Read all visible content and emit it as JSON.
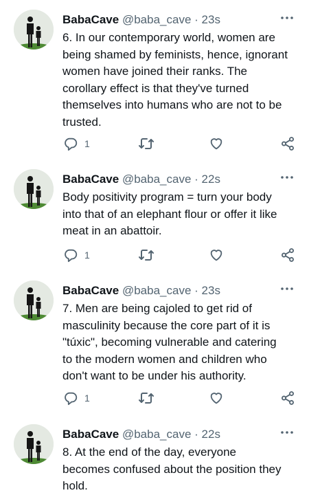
{
  "tweets": [
    {
      "display_name": "BabaCave",
      "handle": "@baba_cave",
      "separator": "·",
      "time": "23s",
      "text": "6. In our contemporary world, women are\nbeing shamed by feminists, hence, ignorant\nwomen have joined their ranks. The\ncorollary effect is that they've turned\nthemselves into humans who are not to be\ntrusted.",
      "reply_count": "1"
    },
    {
      "display_name": "BabaCave",
      "handle": "@baba_cave",
      "separator": "·",
      "time": "22s",
      "text": "Body positivity program = turn your body\ninto that of an elephant flour or offer it like\nmeat in an abattoir.",
      "reply_count": "1"
    },
    {
      "display_name": "BabaCave",
      "handle": "@baba_cave",
      "separator": "·",
      "time": "23s",
      "text": "7. Men are being cajoled to get rid of\nmasculinity because the core part of it is\n\"túxic\", becoming vulnerable and catering\nto the modern women and children who\ndon't want to be under his authority.",
      "reply_count": "1"
    },
    {
      "display_name": "BabaCave",
      "handle": "@baba_cave",
      "separator": "·",
      "time": "22s",
      "text": "8. At the end of the day, everyone\nbecomes confused about the position they\nhold.",
      "reply_count": ""
    }
  ],
  "icons": {
    "reply": "reply-icon",
    "retweet": "retweet-icon",
    "like": "like-icon",
    "share": "share-icon",
    "more": "more-icon",
    "avatar": "avatar"
  },
  "colors": {
    "text": "#0f1419",
    "secondary": "#536471",
    "background": "#ffffff"
  }
}
